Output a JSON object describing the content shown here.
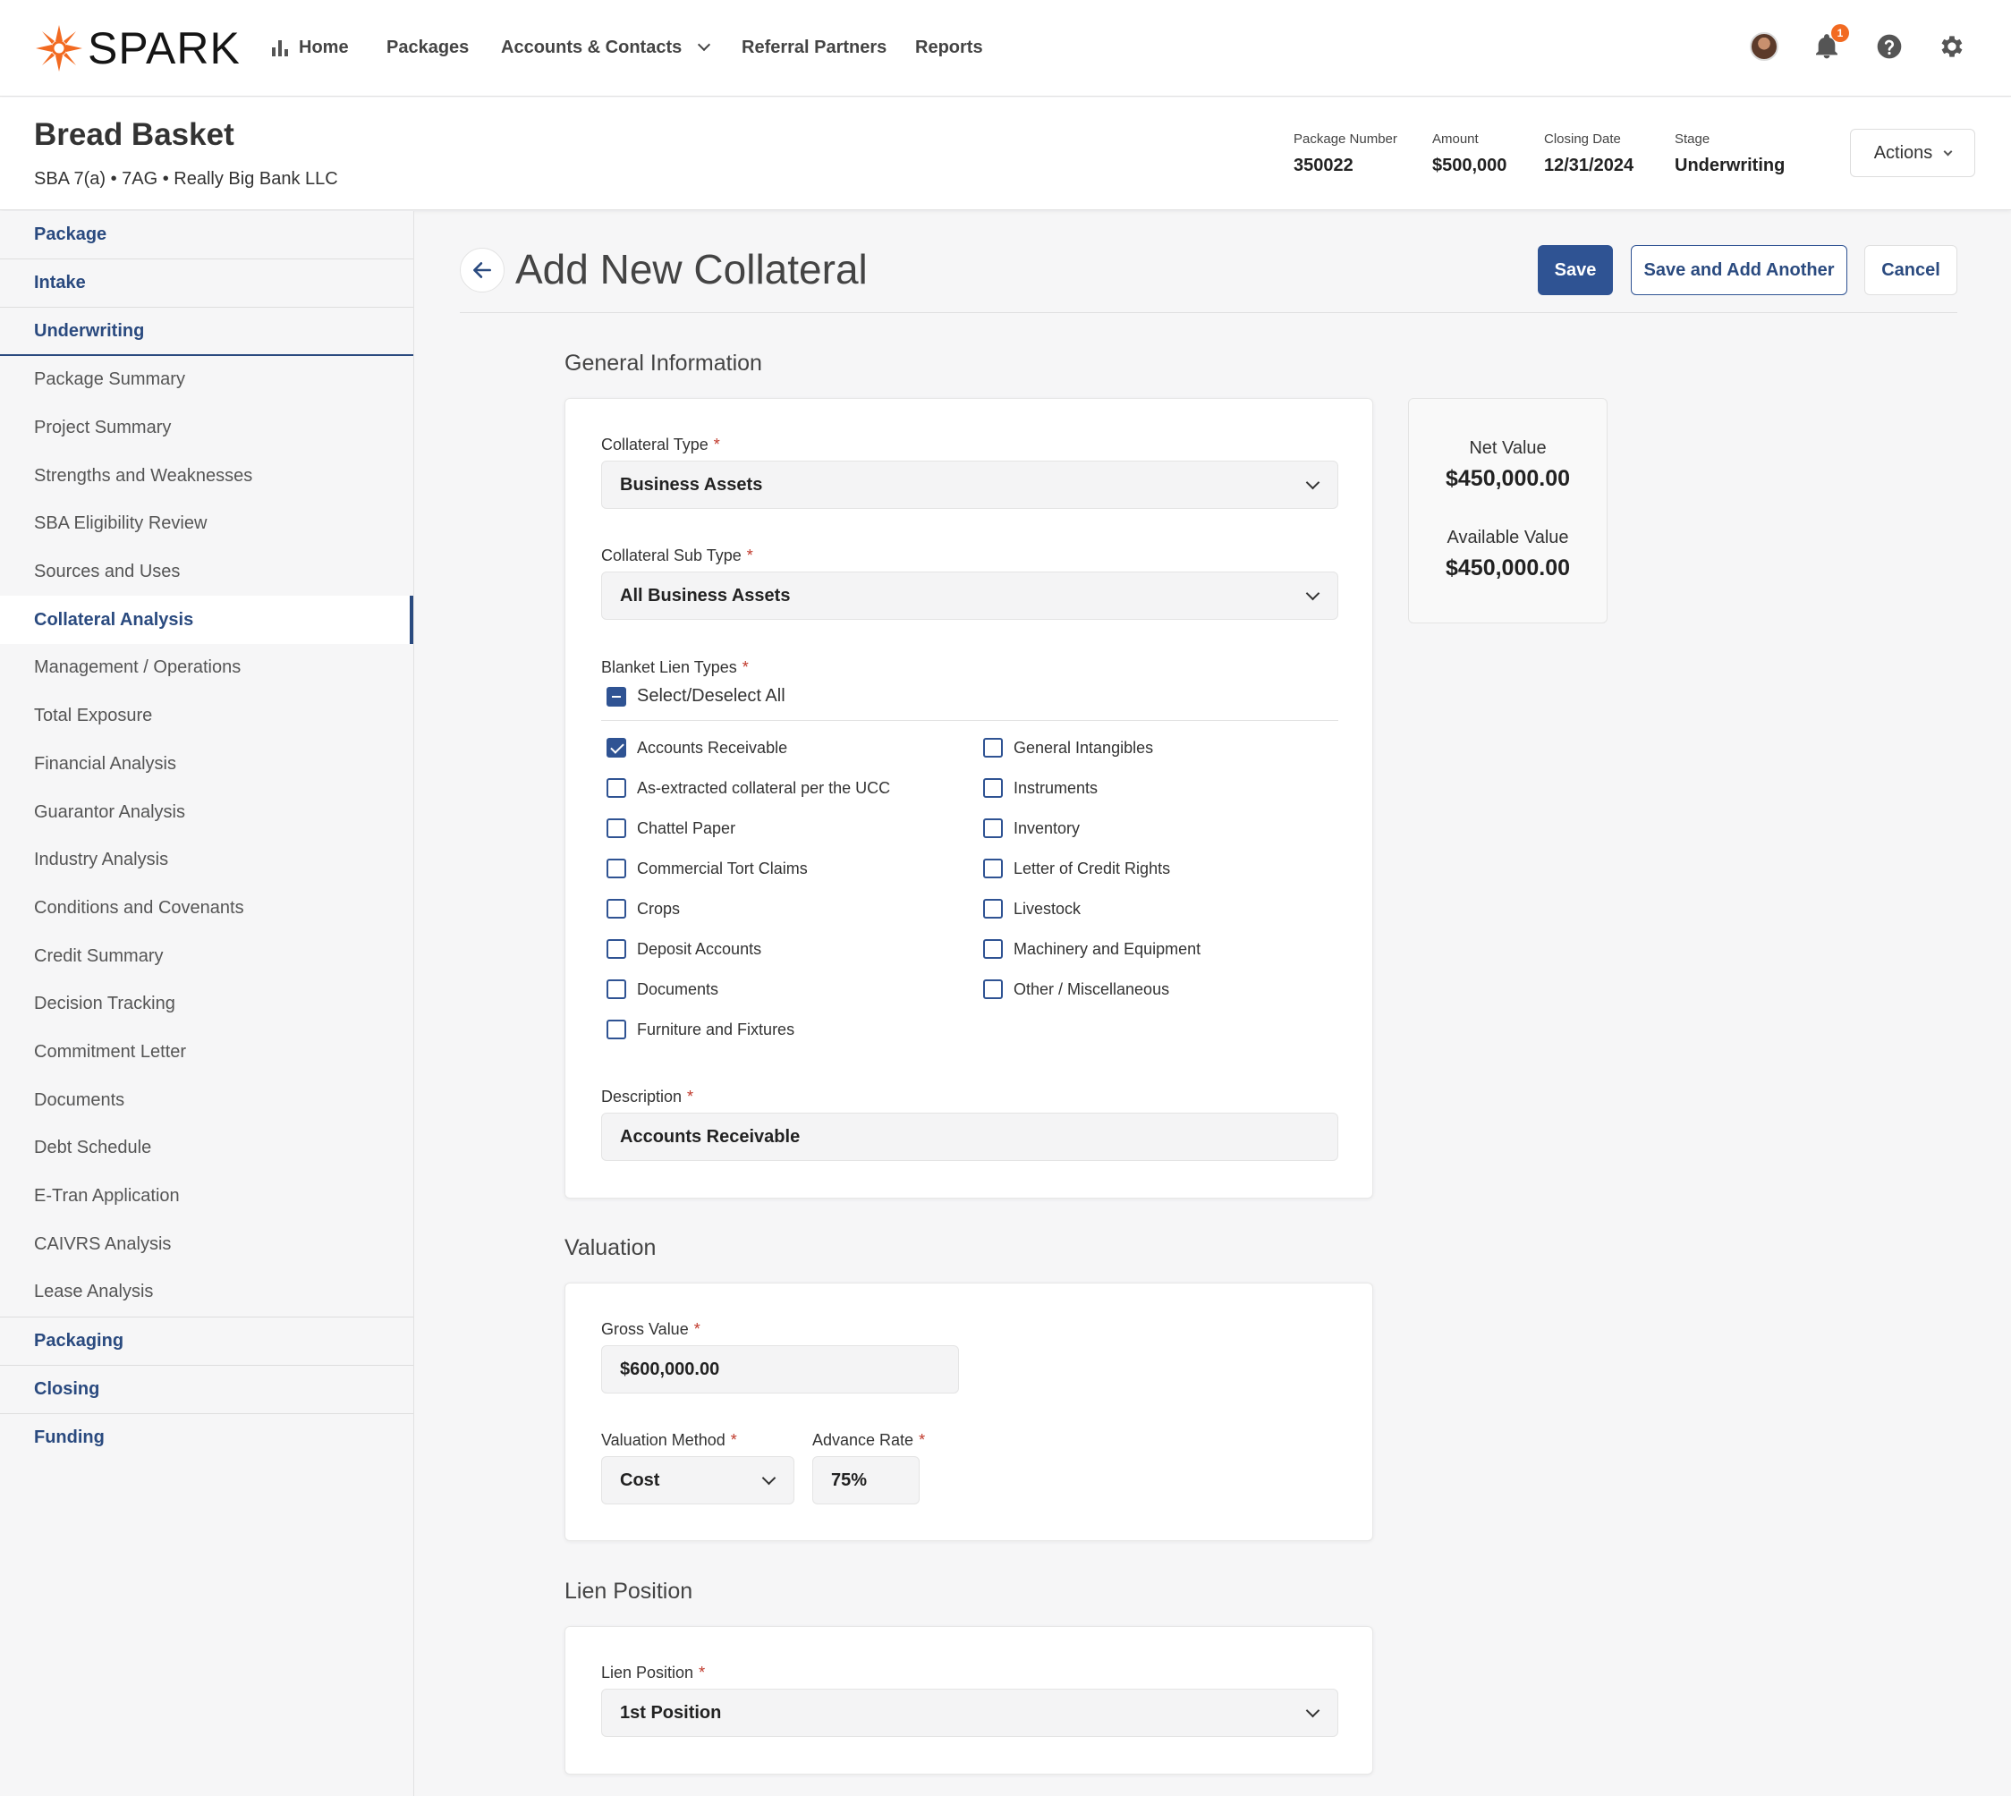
{
  "nav": {
    "brand": "SPARK",
    "items": [
      "Home",
      "Packages",
      "Accounts & Contacts",
      "Referral Partners",
      "Reports"
    ],
    "notification_count": "1"
  },
  "package": {
    "title": "Bread Basket",
    "subtitle": "SBA 7(a) • 7AG • Really Big Bank LLC",
    "meta": [
      {
        "label": "Package Number",
        "value": "350022"
      },
      {
        "label": "Amount",
        "value": "$500,000"
      },
      {
        "label": "Closing Date",
        "value": "12/31/2024"
      },
      {
        "label": "Stage",
        "value": "Underwriting"
      }
    ],
    "actions_label": "Actions"
  },
  "sidebar": {
    "sections_top": [
      "Package",
      "Intake",
      "Underwriting"
    ],
    "items": [
      "Package Summary",
      "Project Summary",
      "Strengths and Weaknesses",
      "SBA Eligibility Review",
      "Sources and Uses",
      "Collateral Analysis",
      "Management / Operations",
      "Total Exposure",
      "Financial Analysis",
      "Guarantor Analysis",
      "Industry Analysis",
      "Conditions and Covenants",
      "Credit Summary",
      "Decision Tracking",
      "Commitment Letter",
      "Documents",
      "Debt Schedule",
      "E-Tran Application",
      "CAIVRS Analysis",
      "Lease Analysis"
    ],
    "current_item": "Collateral Analysis",
    "sections_bottom": [
      "Packaging",
      "Closing",
      "Funding"
    ]
  },
  "page": {
    "title": "Add New Collateral",
    "save": "Save",
    "save_add": "Save and Add Another",
    "cancel": "Cancel"
  },
  "general": {
    "section_title": "General Information",
    "collateral_type_label": "Collateral Type",
    "collateral_type": "Business Assets",
    "sub_type_label": "Collateral Sub Type",
    "sub_type": "All Business Assets",
    "lien_types_label": "Blanket Lien Types",
    "select_all": "Select/Deselect All",
    "lien_col1": [
      {
        "label": "Accounts Receivable",
        "checked": true
      },
      {
        "label": "As-extracted collateral per the UCC",
        "checked": false
      },
      {
        "label": "Chattel Paper",
        "checked": false
      },
      {
        "label": "Commercial Tort Claims",
        "checked": false
      },
      {
        "label": "Crops",
        "checked": false
      },
      {
        "label": "Deposit Accounts",
        "checked": false
      },
      {
        "label": "Documents",
        "checked": false
      },
      {
        "label": "Furniture and Fixtures",
        "checked": false
      }
    ],
    "lien_col2": [
      {
        "label": "General Intangibles",
        "checked": false
      },
      {
        "label": "Instruments",
        "checked": false
      },
      {
        "label": "Inventory",
        "checked": false
      },
      {
        "label": "Letter of Credit Rights",
        "checked": false
      },
      {
        "label": "Livestock",
        "checked": false
      },
      {
        "label": "Machinery and Equipment",
        "checked": false
      },
      {
        "label": "Other / Miscellaneous",
        "checked": false
      }
    ],
    "description_label": "Description",
    "description": "Accounts Receivable"
  },
  "summary": {
    "net_label": "Net Value",
    "net_value": "$450,000.00",
    "available_label": "Available Value",
    "available_value": "$450,000.00"
  },
  "valuation": {
    "section_title": "Valuation",
    "gross_label": "Gross Value",
    "gross_value": "$600,000.00",
    "method_label": "Valuation Method",
    "method_value": "Cost",
    "advance_label": "Advance Rate",
    "advance_value": "75%"
  },
  "lien": {
    "section_title": "Lien Position",
    "label": "Lien Position",
    "value": "1st Position"
  },
  "colors": {
    "primary": "#2f5393",
    "accent": "#f26a21",
    "required": "#c0392b"
  }
}
